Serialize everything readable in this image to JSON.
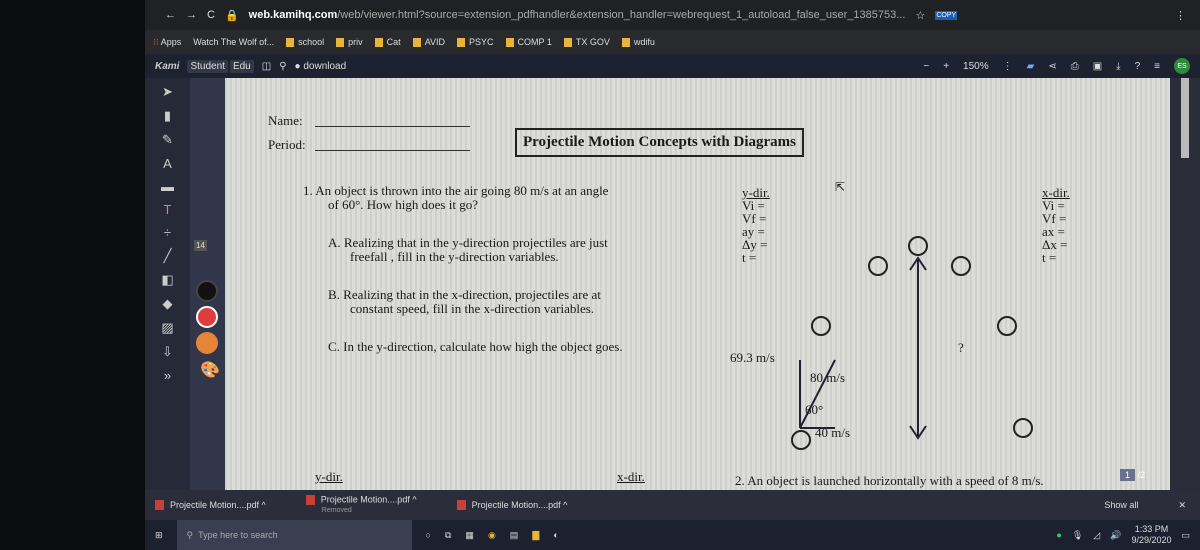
{
  "browser": {
    "url_domain": "web.kamihq.com",
    "url_path": "/web/viewer.html?source=extension_pdfhandler&extension_handler=webrequest_1_autoload_false_user_1385753...",
    "ext_copy": "COPY"
  },
  "bookmarks": [
    "Apps",
    "Watch The Wolf of...",
    "school",
    "priv",
    "Cat",
    "AVID",
    "PSYC",
    "COMP 1",
    "TX GOV",
    "wdifu"
  ],
  "kami": {
    "logo": "Kami",
    "badge1": "Student",
    "badge2": "Edu",
    "download": "download",
    "zoom": "150%",
    "avatar": "ES",
    "font_size": "14"
  },
  "doc": {
    "name": "Name:",
    "period": "Period:",
    "title": "Projectile Motion Concepts with Diagrams",
    "q1": "1.  An object is thrown into the air going 80 m/s at an angle",
    "q1b": "of 60°.  How high does it go?",
    "a": "A.  Realizing that in the y-direction projectiles are just",
    "a2": "freefall , fill in the y-direction variables.",
    "b": "B.  Realizing that in the x-direction, projectiles are at",
    "b2": "constant speed, fill in the x-direction variables.",
    "c": "C.  In the y-direction, calculate how high the object goes.",
    "ydir": "y-dir.",
    "ylist": [
      "Vi =",
      "Vf =",
      "ay =",
      "Δy =",
      "t ="
    ],
    "xdir": "x-dir.",
    "xlist": [
      "Vi =",
      "Vf =",
      "ax =",
      "Δx =",
      "t ="
    ],
    "v_y": "69.3 m/s",
    "v": "80 m/s",
    "angle": "60°",
    "v_x": "40 m/s",
    "q": "?",
    "bottom_ydir": "y-dir.",
    "bottom_xdir": "x-dir.",
    "q2": "2.   An object is launched horizontally with a speed of 8 m/s.",
    "page": "1",
    "pages": "2"
  },
  "downloads": {
    "items": [
      {
        "name": "Projectile Motion....pdf",
        "status": ""
      },
      {
        "name": "Projectile Motion....pdf",
        "status": "Removed"
      },
      {
        "name": "Projectile Motion....pdf",
        "status": ""
      }
    ],
    "show_all": "Show all"
  },
  "taskbar": {
    "search_placeholder": "Type here to search",
    "time": "1:33 PM",
    "date": "9/29/2020"
  },
  "colors": {
    "swatch1": "#111111",
    "swatch2": "#e03c3c",
    "swatch3": "#e8843a",
    "accent": "#2e8b3a"
  }
}
